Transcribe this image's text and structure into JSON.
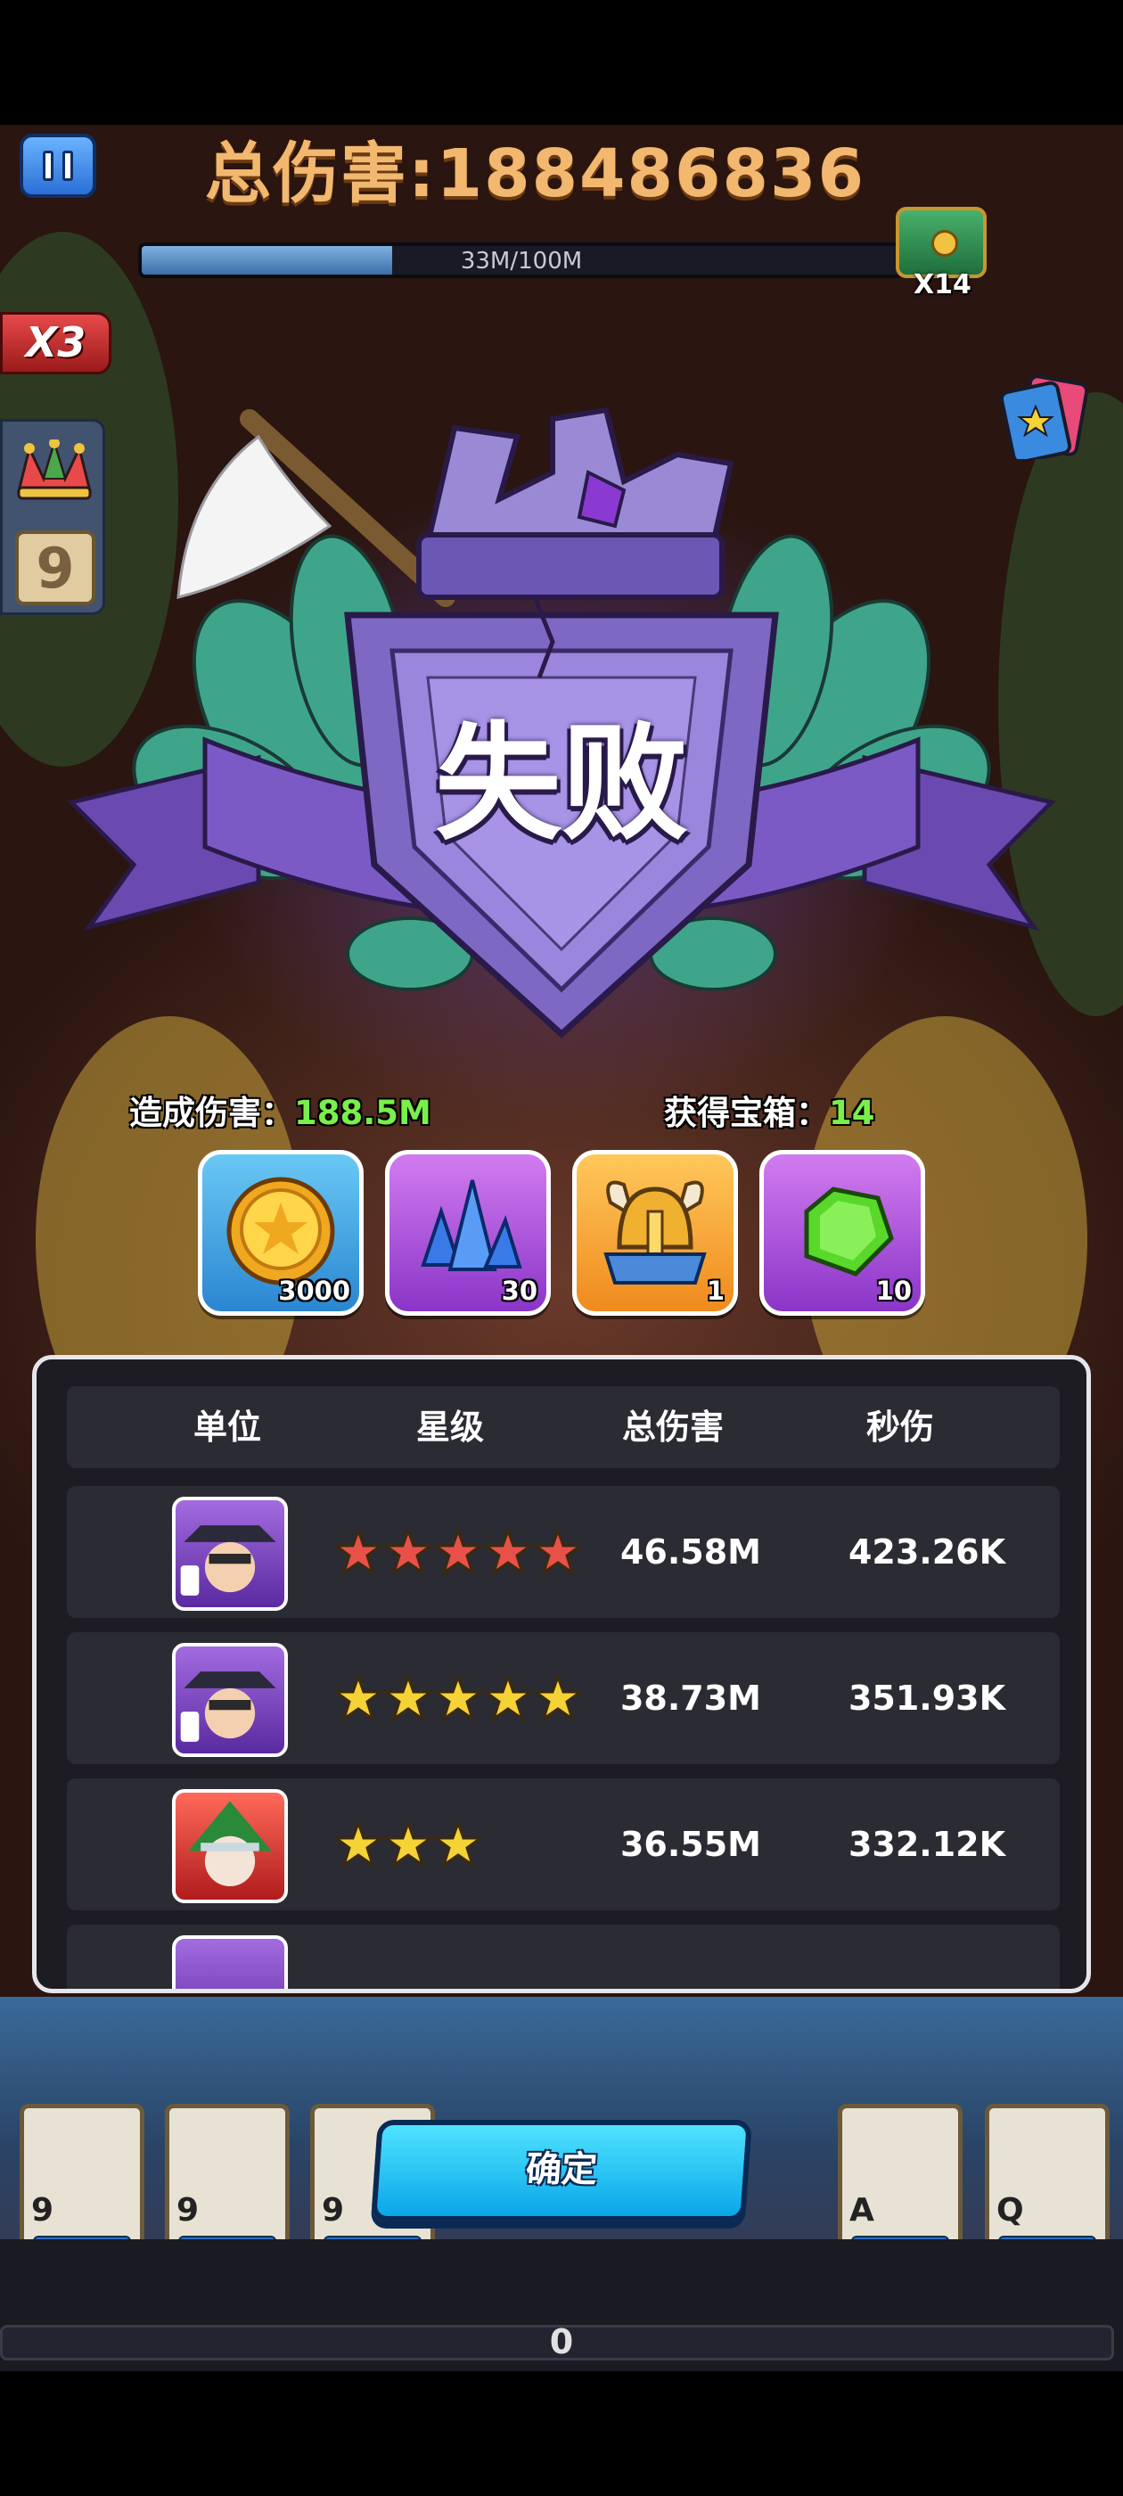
{
  "hud": {
    "total_damage_label": "总伤害:188486836",
    "progress_text": "33M/100M",
    "progress_fraction": 0.33,
    "chest_count": "X14",
    "multiplier": "X3",
    "joker_level": "9"
  },
  "result": {
    "title": "失败",
    "damage_label": "造成伤害：",
    "damage_value": "188.5M",
    "chest_label": "获得宝箱：",
    "chest_value": "14"
  },
  "rewards": [
    {
      "icon": "gold-coin-icon",
      "qty": "3000"
    },
    {
      "icon": "blue-crystal-icon",
      "qty": "30"
    },
    {
      "icon": "viking-helmet-icon",
      "qty": "1"
    },
    {
      "icon": "green-gem-icon",
      "qty": "10"
    }
  ],
  "stats": {
    "headers": [
      "单位",
      "星级",
      "总伤害",
      "秒伤"
    ],
    "rows": [
      {
        "portrait": "purple-hat-hero-portrait",
        "stars": 5,
        "star_color": "#e8514a",
        "total": "46.58M",
        "dps": "423.26K"
      },
      {
        "portrait": "purple-hat-hero-portrait",
        "stars": 5,
        "star_color": "#f5d236",
        "total": "38.73M",
        "dps": "351.93K"
      },
      {
        "portrait": "green-hood-hero-portrait",
        "stars": 3,
        "star_color": "#f5d236",
        "total": "36.55M",
        "dps": "332.12K"
      }
    ]
  },
  "bottom": {
    "confirm_label": "确定",
    "cards": [
      "9",
      "9",
      "9",
      "A",
      "Q"
    ],
    "counter": "0"
  },
  "colors": {
    "accent_green": "#79f04a",
    "button_blue": "#1ab8f0",
    "panel_bg": "#1c1c22"
  }
}
